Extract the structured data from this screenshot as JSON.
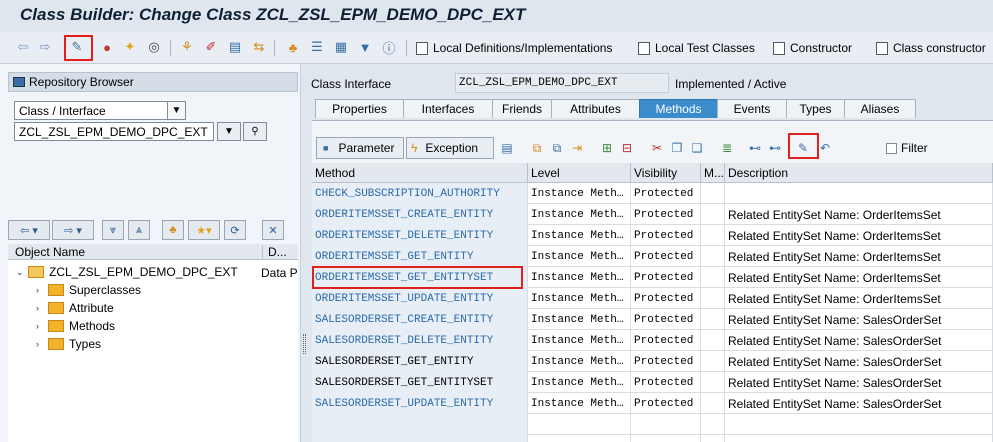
{
  "title": "Class Builder: Change Class ZCL_ZSL_EPM_DEMO_DPC_EXT",
  "toolbar": {
    "buttons": [
      {
        "label": "Local Definitions/Implementations"
      },
      {
        "label": "Local Test Classes"
      },
      {
        "label": "Constructor"
      },
      {
        "label": "Class constructor"
      }
    ]
  },
  "left": {
    "repo_header": "Repository Browser",
    "object_type": "Class / Interface",
    "object_name": "ZCL_ZSL_EPM_DEMO_DPC_EXT",
    "tree_header": {
      "col1": "Object Name",
      "col2": "D..."
    },
    "tree": {
      "root": "ZCL_ZSL_EPM_DEMO_DPC_EXT",
      "root_desc": "Data P",
      "children": [
        "Superclasses",
        "Attribute",
        "Methods",
        "Types"
      ]
    }
  },
  "right": {
    "class_interface_label": "Class Interface",
    "class_interface_value": "ZCL_ZSL_EPM_DEMO_DPC_EXT",
    "status": "Implemented / Active",
    "tabs": [
      "Properties",
      "Interfaces",
      "Friends",
      "Attributes",
      "Methods",
      "Events",
      "Types",
      "Aliases"
    ],
    "active_tab": "Methods",
    "subtoolbar": {
      "parameter": "Parameter",
      "exception": "Exception",
      "filter": "Filter"
    },
    "columns": [
      "Method",
      "Level",
      "Visibility",
      "M...",
      "Description"
    ],
    "rows": [
      {
        "method": "CHECK_SUBSCRIPTION_AUTHORITY",
        "level": "Instance Meth…",
        "visibility": "Protected",
        "desc": ""
      },
      {
        "method": "ORDERITEMSSET_CREATE_ENTITY",
        "level": "Instance Meth…",
        "visibility": "Protected",
        "desc": "Related EntitySet Name: OrderItemsSet"
      },
      {
        "method": "ORDERITEMSSET_DELETE_ENTITY",
        "level": "Instance Meth…",
        "visibility": "Protected",
        "desc": "Related EntitySet Name: OrderItemsSet"
      },
      {
        "method": "ORDERITEMSSET_GET_ENTITY",
        "level": "Instance Meth…",
        "visibility": "Protected",
        "desc": "Related EntitySet Name: OrderItemsSet"
      },
      {
        "method": "ORDERITEMSSET_GET_ENTITYSET",
        "level": "Instance Meth…",
        "visibility": "Protected",
        "desc": "Related EntitySet Name: OrderItemsSet"
      },
      {
        "method": "ORDERITEMSSET_UPDATE_ENTITY",
        "level": "Instance Meth…",
        "visibility": "Protected",
        "desc": "Related EntitySet Name: OrderItemsSet"
      },
      {
        "method": "SALESORDERSET_CREATE_ENTITY",
        "level": "Instance Meth…",
        "visibility": "Protected",
        "desc": "Related EntitySet Name: SalesOrderSet"
      },
      {
        "method": "SALESORDERSET_DELETE_ENTITY",
        "level": "Instance Meth…",
        "visibility": "Protected",
        "desc": "Related EntitySet Name: SalesOrderSet"
      },
      {
        "method": "SALESORDERSET_GET_ENTITY",
        "level": "Instance Meth…",
        "visibility": "Protected",
        "desc": "Related EntitySet Name: SalesOrderSet"
      },
      {
        "method": "SALESORDERSET_GET_ENTITYSET",
        "level": "Instance Meth…",
        "visibility": "Protected",
        "desc": "Related EntitySet Name: SalesOrderSet"
      },
      {
        "method": "SALESORDERSET_UPDATE_ENTITY",
        "level": "Instance Meth…",
        "visibility": "Protected",
        "desc": "Related EntitySet Name: SalesOrderSet"
      }
    ]
  },
  "colors": {
    "link": "#2b6aa8",
    "active_tab": "#3b8ccd",
    "highlight": "#e0201b"
  }
}
